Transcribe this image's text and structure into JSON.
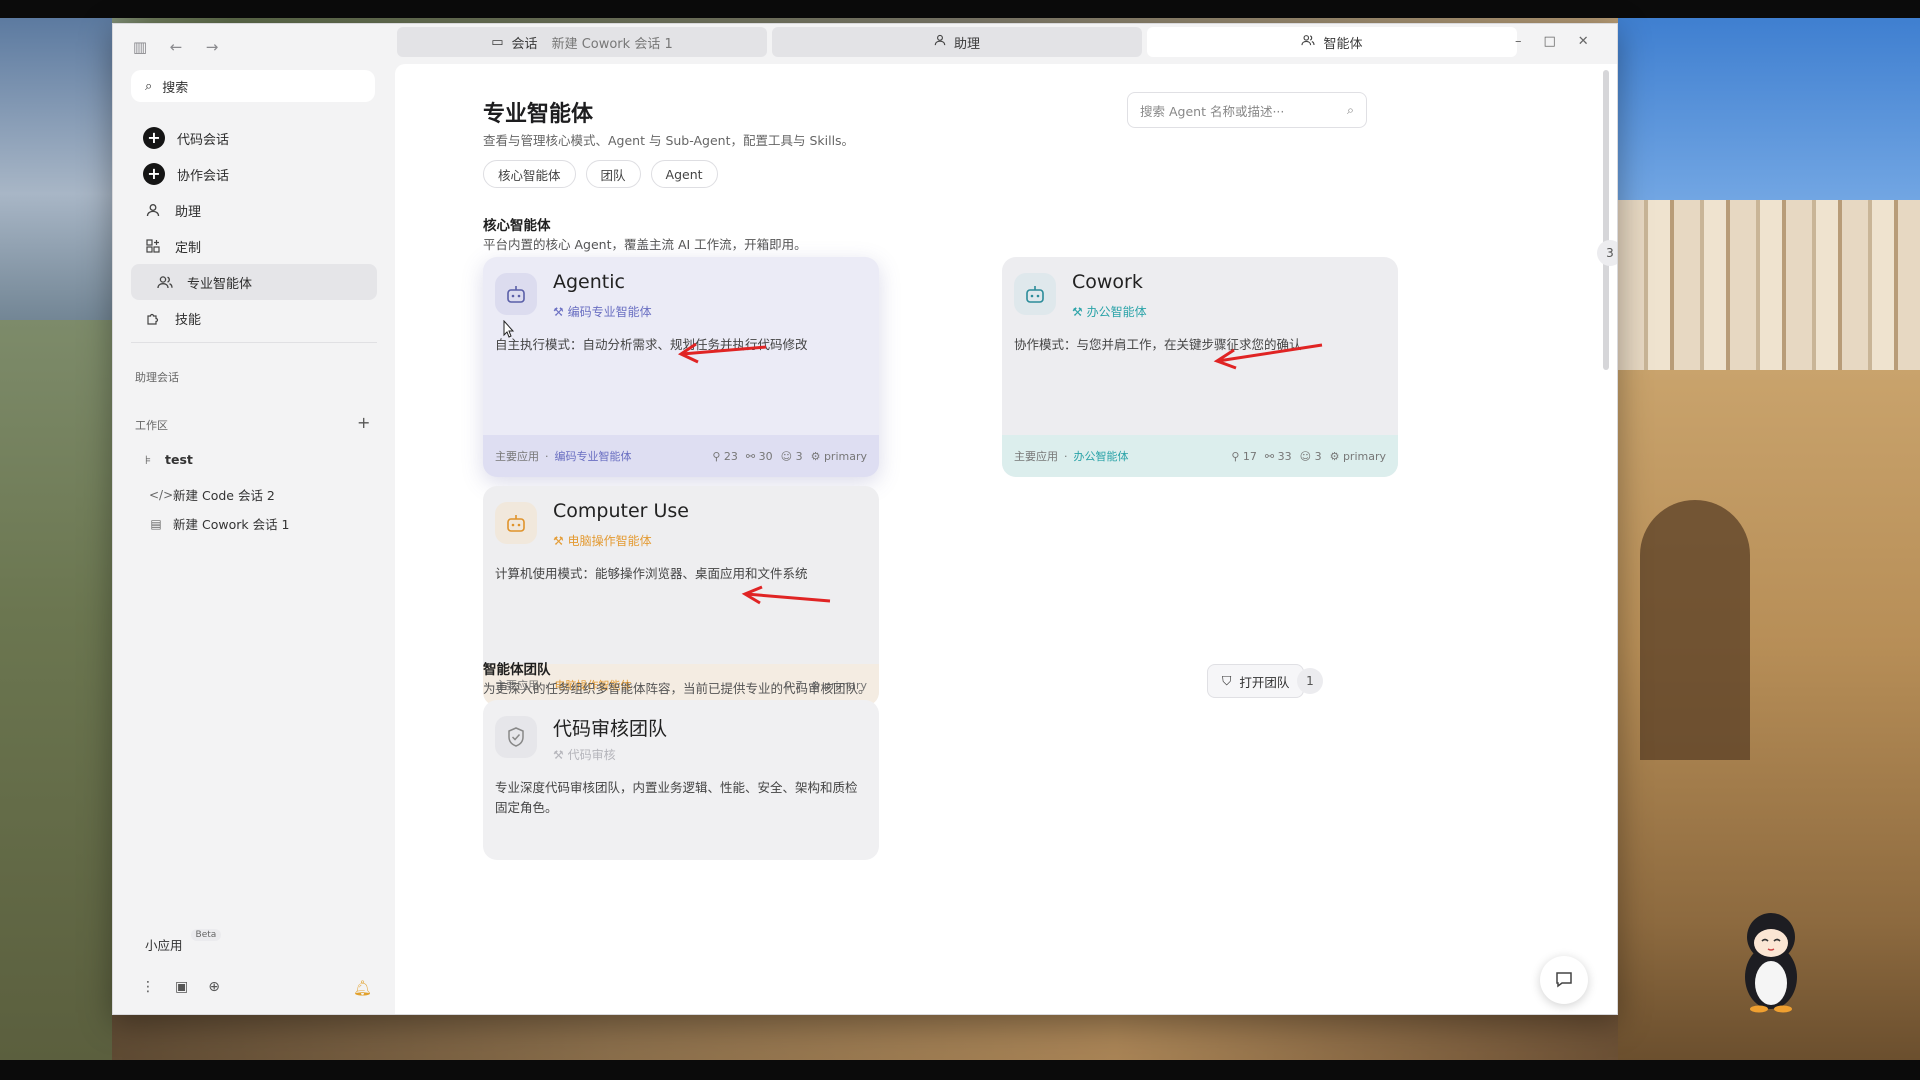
{
  "sidebar": {
    "search_label": "搜索",
    "nav": [
      {
        "label": "代码会话"
      },
      {
        "label": "协作会话"
      },
      {
        "label": "助理"
      },
      {
        "label": "定制"
      },
      {
        "label": "专业智能体"
      },
      {
        "label": "技能"
      }
    ],
    "assistant_sessions_label": "助理会话",
    "workspace_label": "工作区",
    "workspace": {
      "project": "test",
      "items": [
        "新建 Code 会话 2",
        "新建 Cowork 会话 1"
      ]
    },
    "mini_apps_label": "小应用",
    "beta_label": "Beta"
  },
  "tabs": [
    {
      "label": "会话",
      "sub": "新建 Cowork 会话 1"
    },
    {
      "label": "助理"
    },
    {
      "label": "智能体"
    }
  ],
  "page": {
    "title": "专业智能体",
    "subtitle": "查看与管理核心模式、Agent 与 Sub-Agent，配置工具与 Skills。",
    "filters": [
      "核心智能体",
      "团队",
      "Agent"
    ],
    "search_placeholder": "搜索 Agent 名称或描述···"
  },
  "core_section": {
    "title": "核心智能体",
    "desc": "平台内置的核心 Agent，覆盖主流 AI 工作流，开箱即用。",
    "count": "3"
  },
  "cards": {
    "agentic": {
      "name": "Agentic",
      "tag": "编码专业智能体",
      "desc": "自主执行模式：自动分析需求、规划任务并执行代码修改",
      "foot_label": "主要应用",
      "foot_app": "编码专业智能体",
      "tools": "23",
      "links": "30",
      "bots": "3",
      "mode": "primary"
    },
    "cowork": {
      "name": "Cowork",
      "tag": "办公智能体",
      "desc": "协作模式：与您并肩工作，在关键步骤征求您的确认",
      "foot_label": "主要应用",
      "foot_app": "办公智能体",
      "tools": "17",
      "links": "33",
      "bots": "3",
      "mode": "primary"
    },
    "computer_use": {
      "name": "Computer Use",
      "tag": "电脑操作智能体",
      "desc": "计算机使用模式：能够操作浏览器、桌面应用和文件系统",
      "foot_label": "主要应用",
      "foot_app": "电脑操作智能体",
      "tools": "7",
      "mode": "primary"
    }
  },
  "team_section": {
    "title": "智能体团队",
    "desc": "为更深入的任务组织多智能体阵容，当前已提供专业的代码审核团队。",
    "open_team_label": "打开团队",
    "count": "1",
    "card": {
      "name": "代码审核团队",
      "tag": "代码审核",
      "desc": "专业深度代码审核团队，内置业务逻辑、性能、安全、架构和质检固定角色。"
    }
  },
  "colors": {
    "agentic_accent": "#6a6fc2",
    "cowork_accent": "#2aa3a8",
    "computer_use_accent": "#e49b33",
    "annotation_arrow": "#e02424"
  }
}
